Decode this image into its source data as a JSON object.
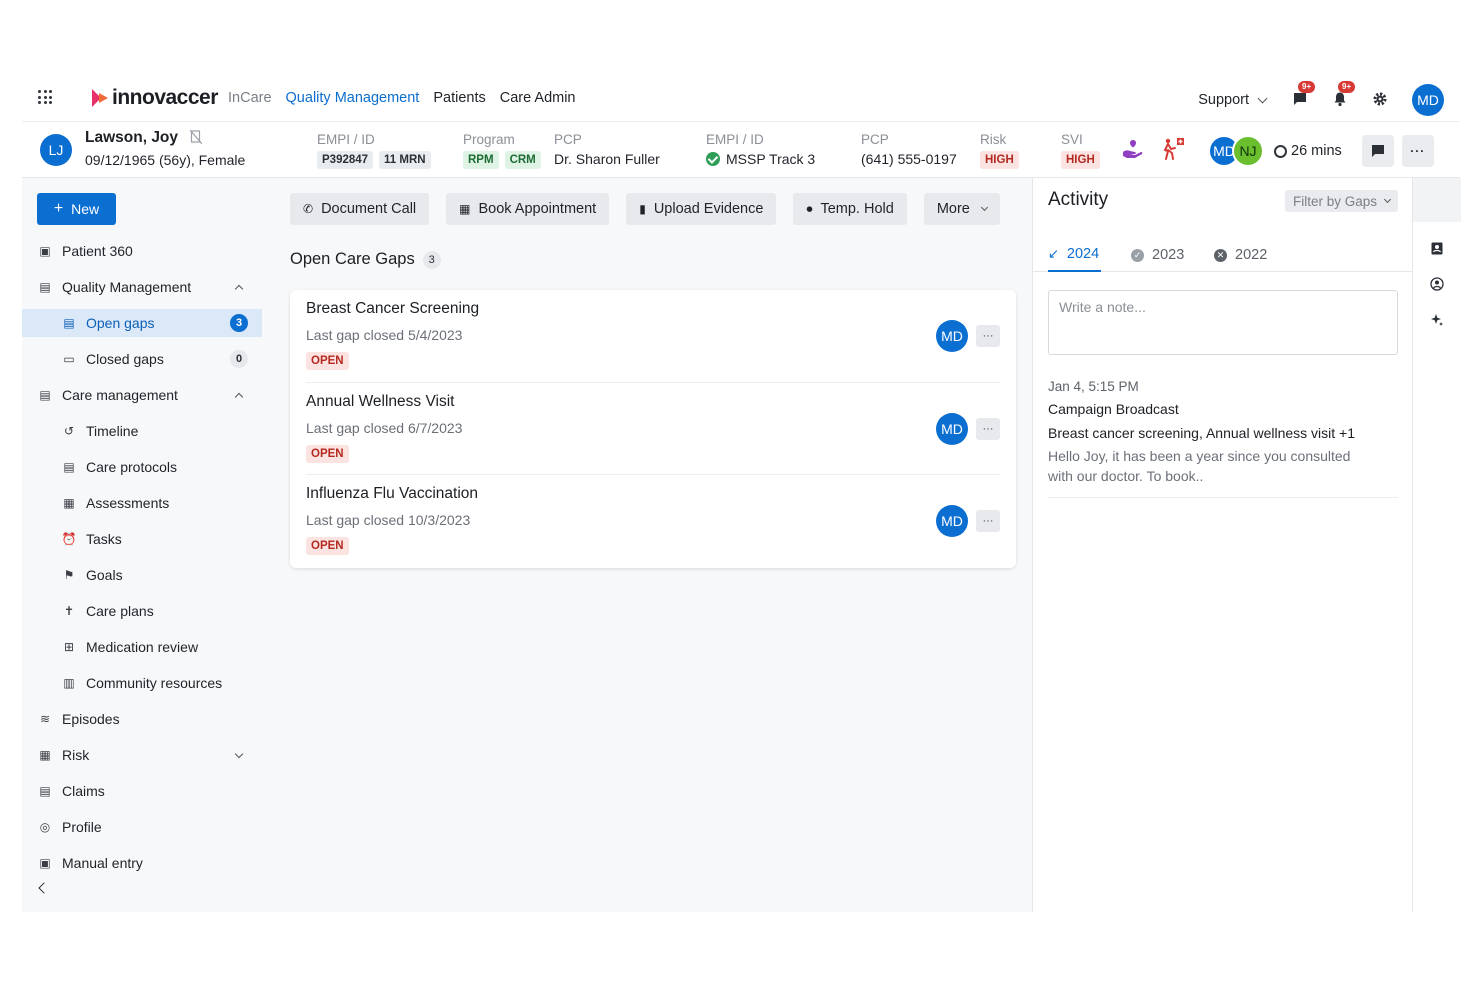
{
  "nav": {
    "logo": "innovaccer",
    "links": [
      "InCare",
      "Quality Management",
      "Patients",
      "Care Admin"
    ],
    "support": "Support",
    "messages_badge": "9+",
    "notifications_badge": "9+",
    "user_initials": "MD"
  },
  "patient": {
    "initials": "LJ",
    "name": "Lawson, Joy",
    "dob_gender": "09/12/1965 (56y), Female",
    "empi_label": "EMPI / ID",
    "empi_chip1": "P392847",
    "empi_chip2": "11 MRN",
    "program_label": "Program",
    "program_chip1": "RPM",
    "program_chip2": "CRM",
    "pcp_label": "PCP",
    "pcp_value": "Dr. Sharon Fuller",
    "empi2_label": "EMPI / ID",
    "empi2_value": "MSSP Track 3",
    "pcp2_label": "PCP",
    "pcp2_value": "(641) 555-0197",
    "risk_label": "Risk",
    "risk_value": "HIGH",
    "svi_label": "SVI",
    "svi_value": "HIGH",
    "avatar1": "MD",
    "avatar2": "NJ",
    "timer": "26 mins"
  },
  "sidebar": {
    "new_label": "New",
    "items": [
      {
        "label": "Patient 360"
      },
      {
        "label": "Quality Management"
      },
      {
        "label": "Open gaps",
        "count": "3"
      },
      {
        "label": "Closed gaps",
        "count": "0"
      },
      {
        "label": "Care management"
      },
      {
        "label": "Timeline"
      },
      {
        "label": "Care protocols"
      },
      {
        "label": "Assessments"
      },
      {
        "label": "Tasks"
      },
      {
        "label": "Goals"
      },
      {
        "label": "Care plans"
      },
      {
        "label": "Medication review"
      },
      {
        "label": "Community resources"
      },
      {
        "label": "Episodes"
      },
      {
        "label": "Risk"
      },
      {
        "label": "Claims"
      },
      {
        "label": "Profile"
      },
      {
        "label": "Manual entry"
      }
    ]
  },
  "toolbar": {
    "document_call": "Document Call",
    "book_appointment": "Book Appointment",
    "upload_evidence": "Upload Evidence",
    "temp_hold": "Temp. Hold",
    "more": "More"
  },
  "gaps": {
    "title": "Open Care Gaps",
    "count": "3",
    "rows": [
      {
        "title": "Breast Cancer Screening",
        "sub": "Last gap closed 5/4/2023",
        "status": "OPEN",
        "assignee": "MD",
        "more": "···"
      },
      {
        "title": "Annual Wellness Visit",
        "sub": "Last gap closed 6/7/2023",
        "status": "OPEN",
        "assignee": "MD",
        "more": "···"
      },
      {
        "title": "Influenza Flu Vaccination",
        "sub": "Last gap closed 10/3/2023",
        "status": "OPEN",
        "assignee": "MD",
        "more": "···"
      }
    ]
  },
  "activity": {
    "title": "Activity",
    "filter": "Filter by Gaps",
    "tabs": [
      "2024",
      "2023",
      "2022"
    ],
    "note_placeholder": "Write a note...",
    "entry": {
      "time": "Jan 4, 5:15 PM",
      "heading": "Campaign Broadcast",
      "line": "Breast cancer screening, Annual wellness visit +1",
      "body": "Hello Joy, it has been a year since you consulted with our doctor. To book.."
    }
  },
  "colors": {
    "primary": "#0b6ed1",
    "danger": "#d73a34",
    "success": "#2f9e57"
  }
}
